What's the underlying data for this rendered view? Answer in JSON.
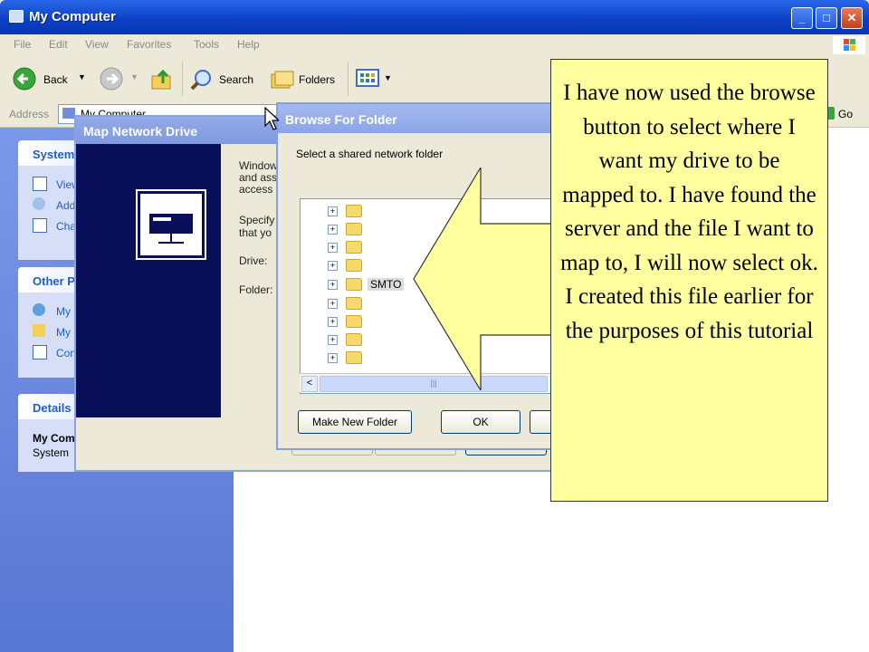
{
  "window": {
    "title": "My Computer",
    "caption_buttons": {
      "minimize": "_",
      "maximize": "□",
      "close": "✕"
    }
  },
  "menubar": [
    "File",
    "Edit",
    "View",
    "Favorites",
    "Tools",
    "Help"
  ],
  "toolbar": {
    "back_label": "Back",
    "search_label": "Search",
    "folders_label": "Folders"
  },
  "addressbar": {
    "label": "Address",
    "value": "My Computer",
    "go_label": "Go"
  },
  "left_pane": {
    "system_tasks": {
      "title": "System",
      "items": [
        "View",
        "Add",
        "Cha"
      ]
    },
    "other_places": {
      "title": "Other P",
      "items": [
        "My",
        "My",
        "Con"
      ]
    },
    "details": {
      "title": "Details",
      "name": "My Com",
      "type": "System"
    }
  },
  "map_network_drive": {
    "title": "Map Network Drive",
    "intro_lines": [
      "Window",
      "and ass",
      "access"
    ],
    "specify_lines": [
      "Specify",
      "that yo"
    ],
    "drive_label": "Drive:",
    "folder_label": "Folder:"
  },
  "browse_for_folder": {
    "title": "Browse For Folder",
    "prompt": "Select a shared network folder",
    "tree_nodes": [
      "",
      "",
      "",
      "",
      "SMTO",
      "",
      "",
      "",
      ""
    ],
    "selected_node": "SMTO",
    "expander_glyph": "+",
    "scroll_left_glyph": "<",
    "scroll_thumb_glyph": "|||",
    "make_new_folder_label": "Make New Folder",
    "ok_label": "OK"
  },
  "callout": {
    "text": "I have now used the browse button to select where I want my drive to be mapped to. I have found the server and the file I want to map to, I will now select ok. I created this file earlier for the purposes of this tutorial",
    "fill_color": "#ffffa0"
  }
}
